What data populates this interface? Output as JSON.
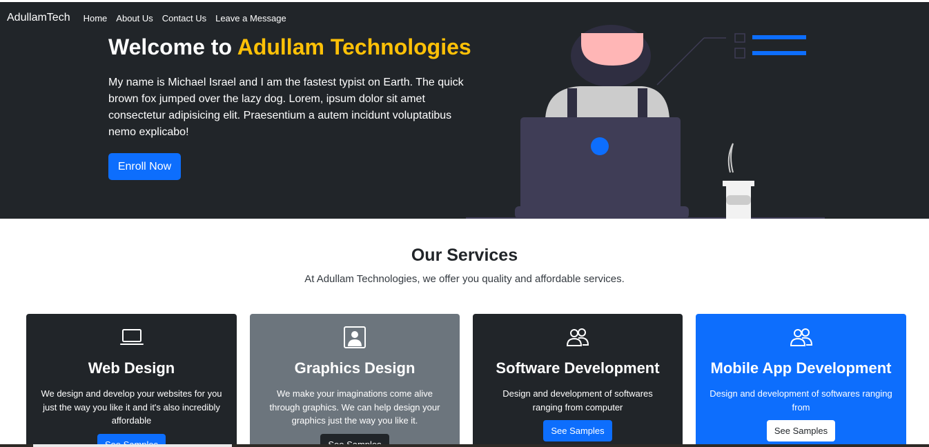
{
  "nav": {
    "brand": "AdullamTech",
    "links": [
      "Home",
      "About Us",
      "Contact Us",
      "Leave a Message"
    ]
  },
  "hero": {
    "title_prefix": "Welcome to ",
    "title_accent": "Adullam Technologies",
    "text": "My name is Michael Israel and I am the fastest typist on Earth. The quick brown fox jumped over the lazy dog. Lorem, ipsum dolor sit amet consectetur adipisicing elit. Praesentium a autem incidunt voluptatibus nemo explicabo!",
    "button": "Enroll Now"
  },
  "services": {
    "title": "Our Services",
    "subtitle": "At Adullam Technologies, we offer you quality and affordable services.",
    "cards": [
      {
        "icon": "laptop-icon",
        "title": "Web Design",
        "text": "We design and develop your websites for you just the way you like it and it's also incredibly affordable",
        "button": "See Samples"
      },
      {
        "icon": "person-square-icon",
        "title": "Graphics Design",
        "text": "We make your imaginations come alive through graphics. We can help design your graphics just the way you like it.",
        "button": "See Samples"
      },
      {
        "icon": "people-icon",
        "title": "Software Development",
        "text": "Design and development of softwares ranging from computer",
        "button": "See Samples"
      },
      {
        "icon": "people-icon",
        "title": "Mobile App Development",
        "text": "Design and development of softwares ranging from",
        "button": "See Samples"
      }
    ]
  },
  "colors": {
    "dark": "#212529",
    "accent": "#ffc107",
    "primary": "#0d6efd",
    "secondary": "#6c757d"
  }
}
